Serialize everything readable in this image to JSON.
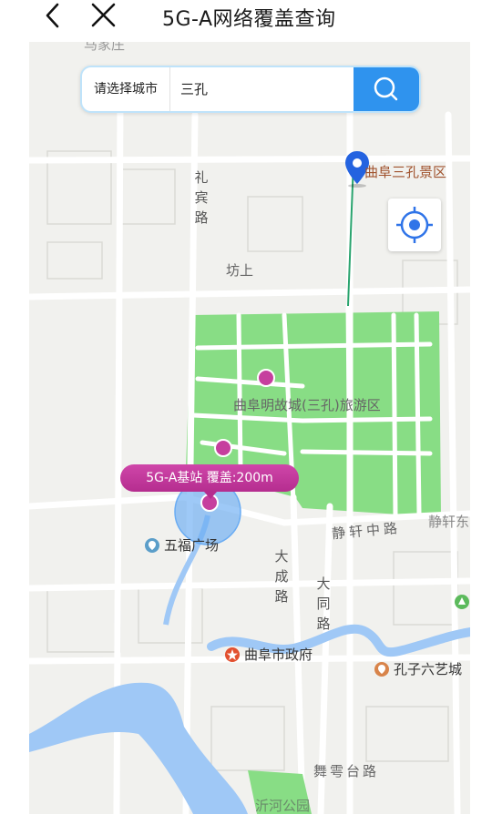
{
  "header": {
    "title": "5G-A网络覆盖查询",
    "back_icon": "chevron-left-icon",
    "close_icon": "close-icon"
  },
  "search": {
    "city_label": "请选择城市",
    "query": "三孔",
    "search_icon": "search-icon"
  },
  "map": {
    "locate_icon": "crosshair-icon",
    "labels": {
      "top_road": "马家庄",
      "libin_road": "礼宾路",
      "fangshang": "坊上",
      "old_city": "曲阜明故城(三孔)旅游区",
      "jingxuan_road": "静轩中路",
      "jingxuan_edge": "静轩东",
      "dacheng_road": "大成路",
      "datong_road": "大同路",
      "wulingtai_road": "舞雩台路",
      "yihe_park": "沂河公园"
    },
    "pois": {
      "sankong": "曲阜三孔景区",
      "wufu_square": "五福广场",
      "government": "曲阜市政府",
      "liuyi_city": "孔子六艺城"
    },
    "tooltip": "5G-A基站 覆盖:200m",
    "colors": {
      "accent": "#2f93ee",
      "station": "#c63f9e",
      "park": "#88dd85",
      "water": "#9fc8f6",
      "coverage": "#6aacf3"
    }
  }
}
